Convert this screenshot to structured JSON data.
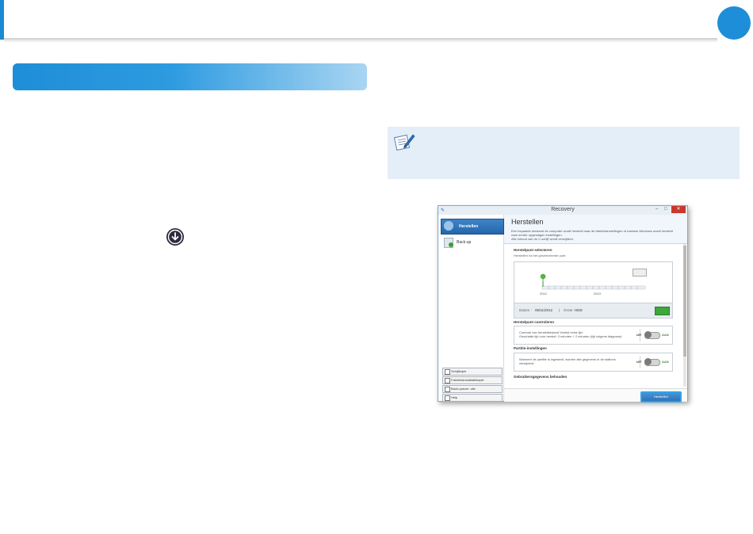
{
  "header": {
    "accent_color": "#1a8ad4"
  },
  "body_icons": {
    "download_icon": "arrow-down-circle-icon",
    "note_icon": "pencil-note-icon"
  },
  "recovery": {
    "title": "Recovery",
    "window_controls": {
      "minimize": "–",
      "maximize": "□",
      "close": "✕"
    },
    "sidebar": {
      "active_item": "Herstellen",
      "items": [
        "Back-up"
      ],
      "buttons": [
        "Schijfkopie",
        "Fabrieksinstallatiekopie",
        "Back-upsom. uitv.",
        "Help"
      ]
    },
    "main": {
      "heading": "Herstellen",
      "description": [
        "Een bepaalde toestand de computer wordt hersteld naar de fabrieksinstellingen of naamse Windows wordt hersteld",
        "naar eerder opgeslagen instellingen.",
        "Alle inhoud van de C-schijf wordt verwijderd."
      ],
      "restore_point": {
        "heading": "Herstelpunt selecteren",
        "subtext": "Herstellen tot het geselecteerde punt.",
        "years": [
          "2012",
          "2013"
        ],
        "date_label": "Datum :",
        "date_value": "05/11/2012",
        "separator": "|",
        "size_label": "Grote :",
        "size_value": "HDD"
      },
      "check": {
        "heading": "Herstelpunt controleren",
        "line1": "Controle van herstelbestand Vereist extra tijd.",
        "line2": "Geschatte tijd voor herstel: 3 minuten + 2 minuten (tijd volgens diagnose)",
        "off_label": "UIT",
        "on_label": "AAN"
      },
      "partition": {
        "heading": "Partitie-instellingen",
        "line1": "Wanneer de partitie is ingesteld, worden alle gegevens in de stations",
        "line2": "verwijderd.",
        "off_label": "UIT",
        "on_label": "AAN"
      },
      "user_data_heading": "Gebruikersgegevens behouden",
      "restore_button": "Herstellen"
    }
  }
}
